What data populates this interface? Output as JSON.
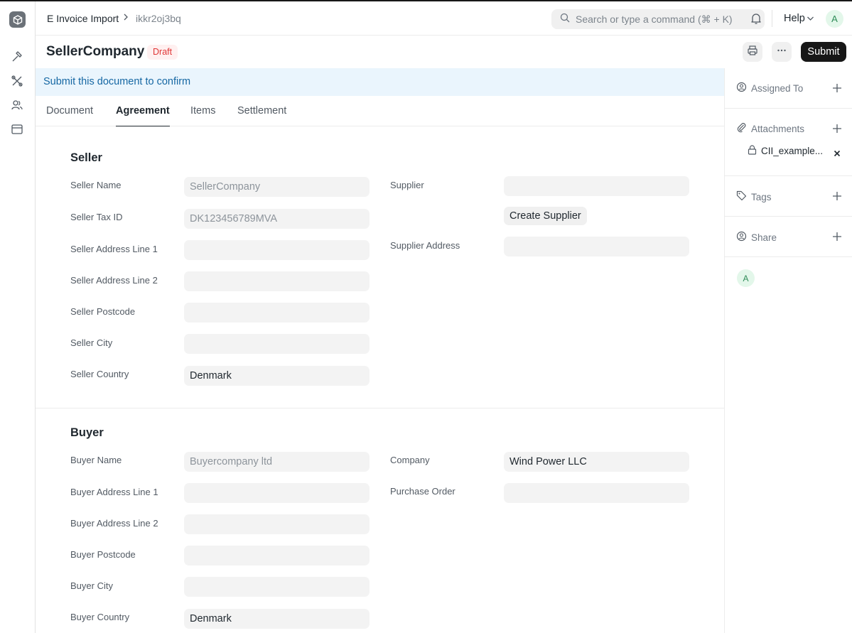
{
  "breadcrumb": {
    "doctype": "E Invoice Import",
    "docname": "ikkr2oj3bq"
  },
  "search": {
    "placeholder": "Search or type a command (⌘ + K)"
  },
  "navbar": {
    "help_label": "Help",
    "avatar_initial": "A"
  },
  "page": {
    "title": "SellerCompany",
    "status": "Draft",
    "submit_label": "Submit"
  },
  "banner": {
    "text": "Submit this document to confirm"
  },
  "tabs": [
    "Document",
    "Agreement",
    "Items",
    "Settlement"
  ],
  "active_tab": "Agreement",
  "seller": {
    "section_title": "Seller",
    "fields": [
      {
        "label": "Seller Name",
        "value": "SellerCompany"
      },
      {
        "label": "Seller Tax ID",
        "value": "DK123456789MVA"
      },
      {
        "label": "Seller Address Line 1",
        "value": ""
      },
      {
        "label": "Seller Address Line 2",
        "value": ""
      },
      {
        "label": "Seller Postcode",
        "value": ""
      },
      {
        "label": "Seller City",
        "value": ""
      },
      {
        "label": "Seller Country",
        "value": "Denmark"
      }
    ],
    "supplier_label": "Supplier",
    "supplier_value": "",
    "create_supplier_label": "Create Supplier",
    "supplier_address_label": "Supplier Address",
    "supplier_address_value": ""
  },
  "buyer": {
    "section_title": "Buyer",
    "fields": [
      {
        "label": "Buyer Name",
        "value": "Buyercompany ltd"
      },
      {
        "label": "Buyer Address Line 1",
        "value": ""
      },
      {
        "label": "Buyer Address Line 2",
        "value": ""
      },
      {
        "label": "Buyer Postcode",
        "value": ""
      },
      {
        "label": "Buyer City",
        "value": ""
      },
      {
        "label": "Buyer Country",
        "value": "Denmark"
      }
    ],
    "company_label": "Company",
    "company_value": "Wind Power LLC",
    "purchase_order_label": "Purchase Order",
    "purchase_order_value": ""
  },
  "sidebar": {
    "assigned_to_label": "Assigned To",
    "attachments_label": "Attachments",
    "attachment_name": "CII_example...",
    "tags_label": "Tags",
    "share_label": "Share",
    "user_initial": "A"
  }
}
